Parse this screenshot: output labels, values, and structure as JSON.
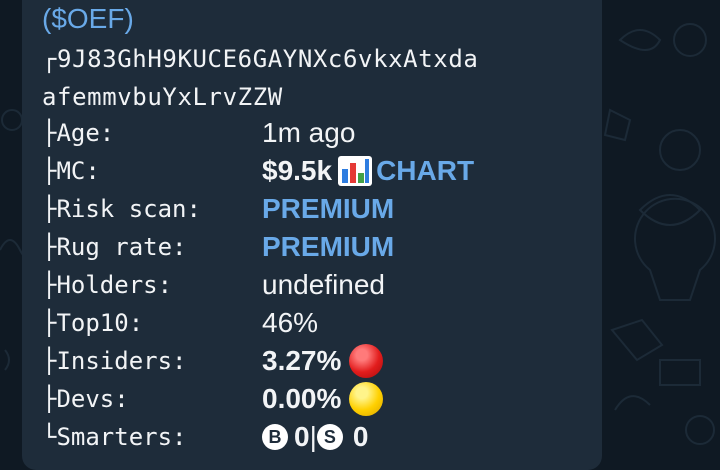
{
  "message": {
    "ticker": "($OEF)",
    "address_line1": "┌9J83GhH9KUCE6GAYNXc6vkxAtxda",
    "address_line2": "afemmvbuYxLrvZZW",
    "rows": [
      {
        "prefix": "├",
        "label": "Age:",
        "value": "1m ago"
      },
      {
        "prefix": "├",
        "label": "MC:",
        "value": "$9.5k",
        "link": "CHART",
        "icon": "bar-chart-icon"
      },
      {
        "prefix": "├",
        "label": "Risk scan:",
        "value": "PREMIUM"
      },
      {
        "prefix": "├",
        "label": "Rug rate:",
        "value": "PREMIUM"
      },
      {
        "prefix": "├",
        "label": "Holders:",
        "value": "undefined"
      },
      {
        "prefix": "├",
        "label": "Top10:",
        "value": "46%"
      },
      {
        "prefix": "├",
        "label": "Insiders:",
        "value": "3.27%",
        "status": "red-circle-icon"
      },
      {
        "prefix": "├",
        "label": "Devs:",
        "value": "0.00%",
        "status": "yellow-circle-icon"
      },
      {
        "prefix": "└",
        "label": "Smarters:",
        "b_letter": "B",
        "b_value": "0",
        "separator": "|",
        "s_letter": "S",
        "s_value": "0"
      }
    ]
  },
  "colors": {
    "background": "#0f1923",
    "bubble": "#1e2c3a",
    "link": "#69a9e8",
    "text": "#f2f4f6"
  }
}
